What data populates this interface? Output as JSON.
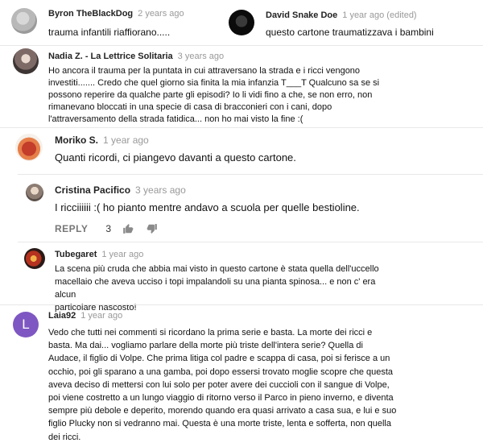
{
  "comments": [
    {
      "author": "Byron TheBlackDog",
      "time": "2 years ago",
      "text": "trauma infantili riaffiorano....."
    },
    {
      "author": "David Snake Doe",
      "time": "1 year ago (edited)",
      "text": "questo cartone traumatizzava i bambini"
    },
    {
      "author": "Nadia Z. - La Lettrice Solitaria",
      "time": "3 years ago",
      "lines": [
        "Ho ancora il trauma per la puntata in cui attraversano la strada e i ricci vengono",
        "investiti....... Credo che quel giorno sia finita la mia infanzia T___T  Qualcuno sa se si",
        "possono reperire da qualche parte gli episodi? Io li vidi fino a che, se non erro, non",
        "rimanevano bloccati in una specie di casa di bracconieri con i cani, dopo",
        "l'attraversamento della strada fatidica... non ho mai visto la fine :("
      ]
    },
    {
      "author": "Moriko S.",
      "time": "1 year ago",
      "text": "Quanti ricordi, ci piangevo davanti a questo cartone."
    },
    {
      "author": "Cristina Pacifico",
      "time": "3 years ago",
      "text": "I ricciiiiii :( ho pianto mentre andavo a scuola per quelle bestioline.",
      "reply_label": "REPLY",
      "likes": "3"
    },
    {
      "author": "Tubegaret",
      "time": "1 year ago",
      "lines": [
        "La scena più cruda che abbia mai visto in questo cartone è stata quella dell'uccello",
        "macellaio che aveva ucciso i topi impalandoli su una pianta spinosa... e non c' era alcun",
        "particolare nascosto!"
      ]
    },
    {
      "author": "Laia92",
      "time": "1 year ago",
      "avatar_letter": "L",
      "avatar_color": "#7e57c2",
      "lines": [
        "Vedo che tutti nei commenti si ricordano la prima serie e basta. La morte dei ricci e",
        "basta. Ma dai... vogliamo parlare della morte più triste dell'intera serie? Quella di",
        "Audace, il figlio di Volpe. Che prima litiga col padre e scappa di casa, poi si ferisce a un",
        "occhio, poi gli sparano a una gamba, poi dopo essersi trovato moglie scopre che questa",
        "aveva deciso di mettersi con lui solo per poter avere dei cuccioli con il sangue di Volpe,",
        "poi viene costretto a un lungo viaggio di ritorno verso il Parco in pieno inverno, e diventa",
        "sempre più debole e deperito, morendo quando era quasi arrivato a casa sua, e lui e suo",
        "figlio Plucky non si vedranno mai. Questa è una morte triste, lenta e sofferta, non quella",
        "dei ricci."
      ]
    }
  ]
}
